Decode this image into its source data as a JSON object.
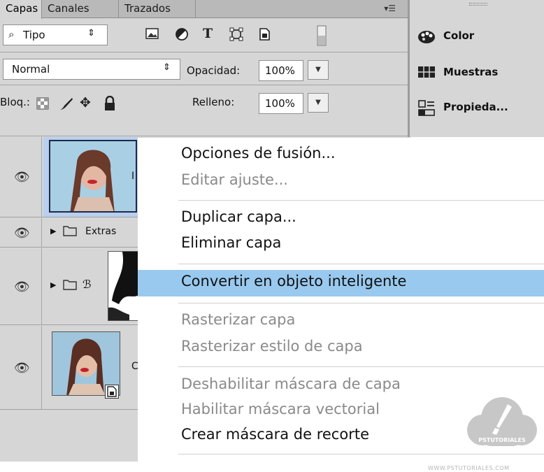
{
  "tabs": [
    "Capas",
    "Canales",
    "Trazados"
  ],
  "filter": {
    "label": "Tipo",
    "icon": "search-icon"
  },
  "filter_icons": [
    "image-filter-icon",
    "adjustment-filter-icon",
    "type-filter-icon",
    "shape-filter-icon",
    "smart-object-filter-icon",
    "filter-toggle-icon"
  ],
  "blend": {
    "mode": "Normal",
    "opacity_label": "Opacidad:",
    "opacity_value": "100%"
  },
  "lock": {
    "label": "Bloq.:",
    "fill_label": "Relleno:",
    "fill_value": "100%"
  },
  "layers": [
    {
      "name": "I",
      "selected": true
    },
    {
      "name": "Extras",
      "type": "group"
    },
    {
      "name": "",
      "type": "group-with-mask"
    },
    {
      "name": "C",
      "type": "smart-object"
    }
  ],
  "dock": [
    {
      "label": "Color",
      "icon": "color-palette-icon"
    },
    {
      "label": "Muestras",
      "icon": "swatches-icon"
    },
    {
      "label": "Propieda...",
      "icon": "properties-icon"
    }
  ],
  "menu": [
    {
      "label": "Opciones de fusión...",
      "state": "enabled"
    },
    {
      "label": "Editar ajuste...",
      "state": "disabled"
    },
    {
      "label": "Duplicar capa...",
      "state": "enabled"
    },
    {
      "label": "Eliminar capa",
      "state": "enabled"
    },
    {
      "label": "Convertir en objeto inteligente",
      "state": "highlight"
    },
    {
      "label": "Rasterizar capa",
      "state": "disabled"
    },
    {
      "label": "Rasterizar estilo de capa",
      "state": "disabled"
    },
    {
      "label": "Deshabilitar máscara de capa",
      "state": "disabled"
    },
    {
      "label": "Habilitar máscara vectorial",
      "state": "disabled"
    },
    {
      "label": "Crear máscara de recorte",
      "state": "enabled"
    }
  ],
  "watermark": {
    "brand": "PSTUTORIALES",
    "url": "WWW.PSTUTORIALES.COM"
  },
  "colors": {
    "highlight": "#99c9ef",
    "panel": "#d6d6d6",
    "selected_layer": "#b8cff0"
  }
}
